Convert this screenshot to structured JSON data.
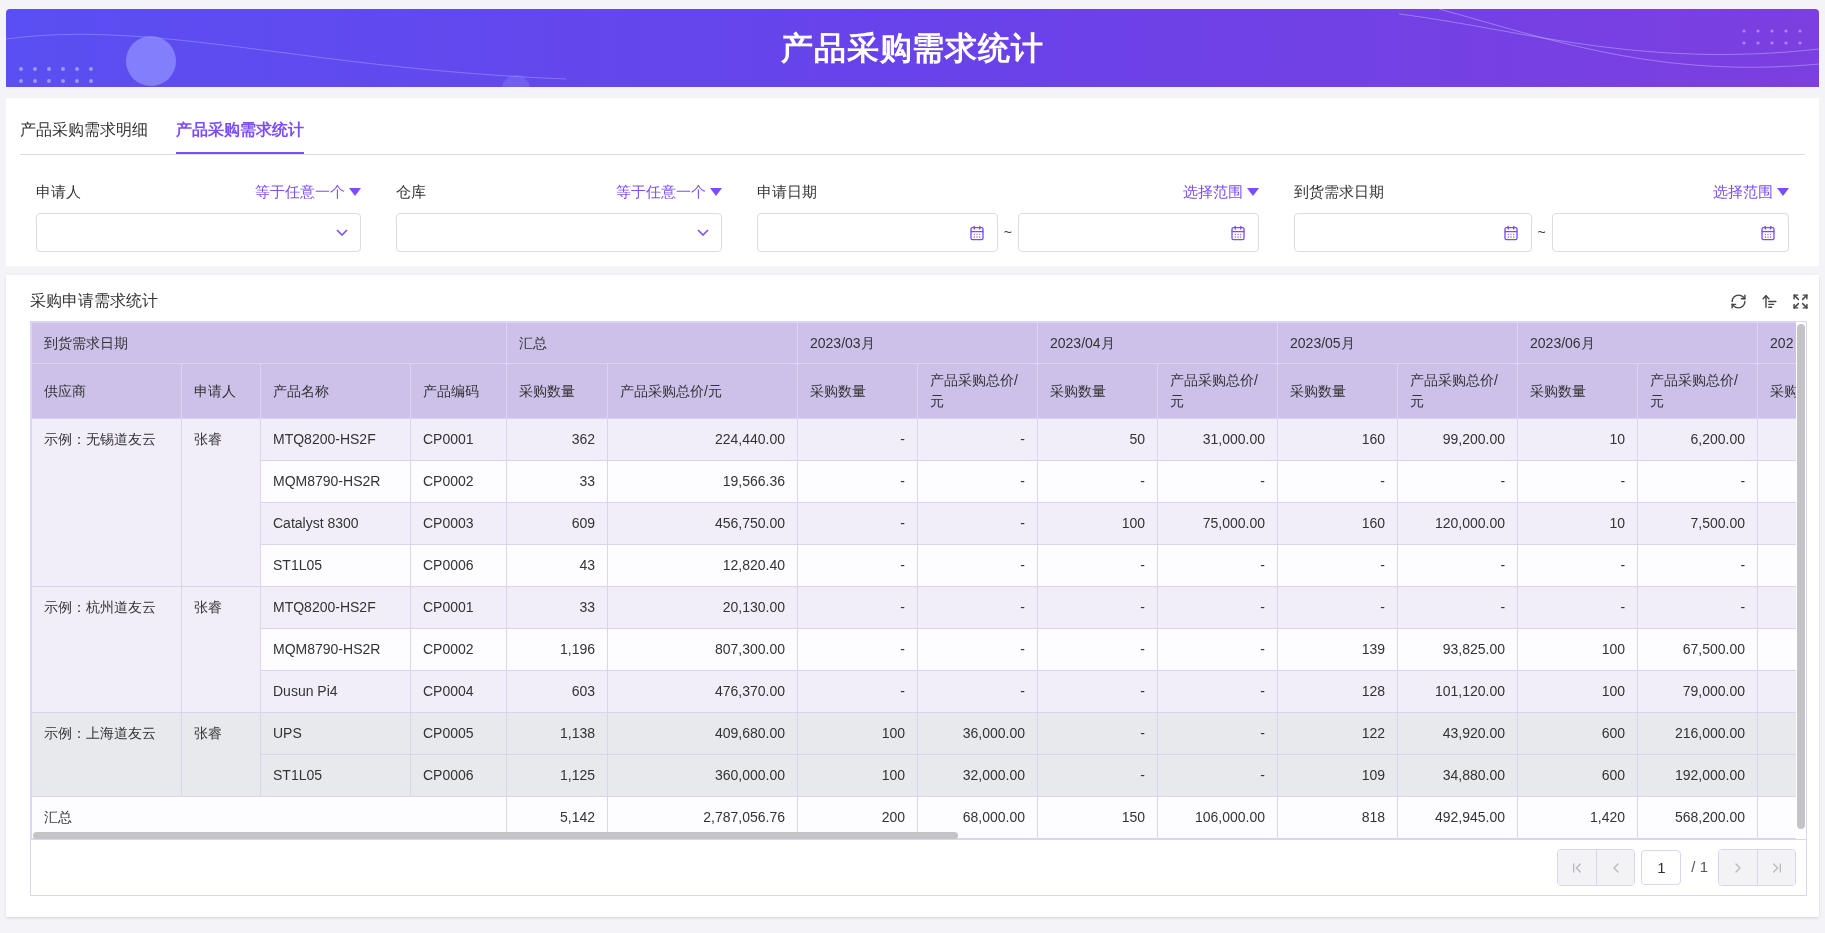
{
  "banner": {
    "title": "产品采购需求统计"
  },
  "tabs": [
    {
      "label": "产品采购需求明细",
      "selected": false
    },
    {
      "label": "产品采购需求统计",
      "selected": true
    }
  ],
  "filters": [
    {
      "label": "申请人",
      "mode": "等于任意一个",
      "kind": "select"
    },
    {
      "label": "仓库",
      "mode": "等于任意一个",
      "kind": "select"
    },
    {
      "label": "申请日期",
      "mode": "选择范围",
      "kind": "daterange",
      "separator": "~"
    },
    {
      "label": "到货需求日期",
      "mode": "选择范围",
      "kind": "daterange",
      "separator": "~"
    }
  ],
  "report": {
    "title": "采购申请需求统计",
    "group_header": "到货需求日期",
    "total_header": "汇总",
    "columns": [
      "供应商",
      "申请人",
      "产品名称",
      "产品编码"
    ],
    "total_columns": [
      "采购数量",
      "产品采购总价/元"
    ],
    "months": [
      {
        "label": "2023/03月",
        "columns": [
          "采购数量",
          "产品采购总价/元"
        ]
      },
      {
        "label": "2023/04月",
        "columns": [
          "采购数量",
          "产品采购总价/元"
        ]
      },
      {
        "label": "2023/05月",
        "columns": [
          "采购数量",
          "产品采购总价/元"
        ]
      },
      {
        "label": "2023/06月",
        "columns": [
          "采购数量",
          "产品采购总价/元"
        ]
      },
      {
        "label": "202",
        "columns": [
          "采购"
        ]
      }
    ],
    "groups": [
      {
        "supplier": "示例：无锡道友云",
        "applicant": "张睿",
        "highlighted": false,
        "rows": [
          {
            "product": "MTQ8200-HS2F",
            "code": "CP0001",
            "qty": "362",
            "price": "224,440.00",
            "values": [
              "-",
              "-",
              "50",
              "31,000.00",
              "160",
              "99,200.00",
              "10",
              "6,200.00"
            ]
          },
          {
            "product": "MQM8790-HS2R",
            "code": "CP0002",
            "qty": "33",
            "price": "19,566.36",
            "values": [
              "-",
              "-",
              "-",
              "-",
              "-",
              "-",
              "-",
              "-"
            ]
          },
          {
            "product": "Catalyst 8300",
            "code": "CP0003",
            "qty": "609",
            "price": "456,750.00",
            "values": [
              "-",
              "-",
              "100",
              "75,000.00",
              "160",
              "120,000.00",
              "10",
              "7,500.00"
            ]
          },
          {
            "product": "ST1L05",
            "code": "CP0006",
            "qty": "43",
            "price": "12,820.40",
            "values": [
              "-",
              "-",
              "-",
              "-",
              "-",
              "-",
              "-",
              "-"
            ]
          }
        ]
      },
      {
        "supplier": "示例：杭州道友云",
        "applicant": "张睿",
        "highlighted": false,
        "rows": [
          {
            "product": "MTQ8200-HS2F",
            "code": "CP0001",
            "qty": "33",
            "price": "20,130.00",
            "values": [
              "-",
              "-",
              "-",
              "-",
              "-",
              "-",
              "-",
              "-"
            ]
          },
          {
            "product": "MQM8790-HS2R",
            "code": "CP0002",
            "qty": "1,196",
            "price": "807,300.00",
            "values": [
              "-",
              "-",
              "-",
              "-",
              "139",
              "93,825.00",
              "100",
              "67,500.00"
            ]
          },
          {
            "product": "Dusun Pi4",
            "code": "CP0004",
            "qty": "603",
            "price": "476,370.00",
            "values": [
              "-",
              "-",
              "-",
              "-",
              "128",
              "101,120.00",
              "100",
              "79,000.00"
            ]
          }
        ]
      },
      {
        "supplier": "示例：上海道友云",
        "applicant": "张睿",
        "highlighted": true,
        "rows": [
          {
            "product": "UPS",
            "code": "CP0005",
            "qty": "1,138",
            "price": "409,680.00",
            "values": [
              "100",
              "36,000.00",
              "-",
              "-",
              "122",
              "43,920.00",
              "600",
              "216,000.00"
            ]
          },
          {
            "product": "ST1L05",
            "code": "CP0006",
            "qty": "1,125",
            "price": "360,000.00",
            "values": [
              "100",
              "32,000.00",
              "-",
              "-",
              "109",
              "34,880.00",
              "600",
              "192,000.00"
            ]
          }
        ]
      }
    ],
    "total": {
      "label": "汇总",
      "qty": "5,142",
      "price": "2,787,056.76",
      "values": [
        "200",
        "68,000.00",
        "150",
        "106,000.00",
        "818",
        "492,945.00",
        "1,420",
        "568,200.00"
      ]
    }
  },
  "pagination": {
    "page": "1",
    "of": "/ 1",
    "first_disabled": true,
    "prev_disabled": true,
    "next_disabled": true,
    "last_disabled": true
  }
}
